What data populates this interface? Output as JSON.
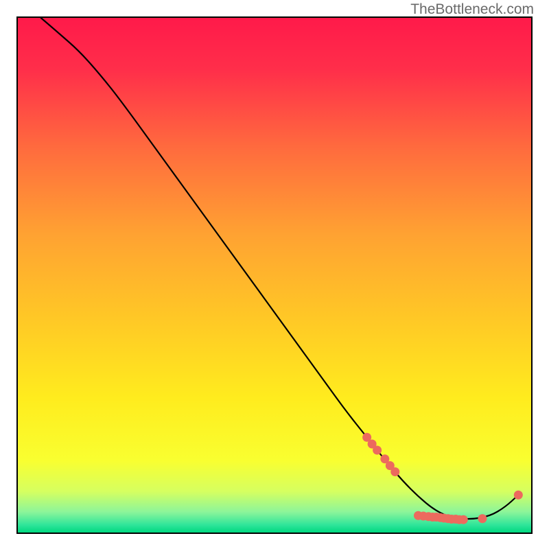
{
  "watermark": "TheBottleneck.com",
  "chart_data": {
    "type": "line",
    "title": "",
    "xlabel": "",
    "ylabel": "",
    "x_range": [
      0,
      100
    ],
    "y_range": [
      0,
      100
    ],
    "note": "No numeric axis ticks or labels visible; values below are normalized positions 0–100 estimated from pixel coordinates.",
    "series": [
      {
        "name": "curve",
        "type": "line",
        "color": "#000000",
        "points": [
          {
            "x": 4.5,
            "y": 100
          },
          {
            "x": 8,
            "y": 97
          },
          {
            "x": 12,
            "y": 93.5
          },
          {
            "x": 16,
            "y": 89
          },
          {
            "x": 20,
            "y": 84
          },
          {
            "x": 28,
            "y": 73
          },
          {
            "x": 36,
            "y": 62
          },
          {
            "x": 44,
            "y": 51
          },
          {
            "x": 52,
            "y": 40
          },
          {
            "x": 60,
            "y": 29
          },
          {
            "x": 64,
            "y": 23.5
          },
          {
            "x": 68,
            "y": 18.5
          },
          {
            "x": 72,
            "y": 13.5
          },
          {
            "x": 75,
            "y": 10
          },
          {
            "x": 78,
            "y": 7
          },
          {
            "x": 81,
            "y": 4.5
          },
          {
            "x": 84,
            "y": 3
          },
          {
            "x": 88,
            "y": 2.5
          },
          {
            "x": 92,
            "y": 3.2
          },
          {
            "x": 95,
            "y": 5
          },
          {
            "x": 97.5,
            "y": 7.3
          }
        ]
      },
      {
        "name": "markers",
        "type": "scatter",
        "color": "#ec6a5e",
        "points": [
          {
            "x": 68,
            "y": 18.5
          },
          {
            "x": 69,
            "y": 17.2
          },
          {
            "x": 70,
            "y": 16
          },
          {
            "x": 71.5,
            "y": 14.3
          },
          {
            "x": 72.5,
            "y": 13
          },
          {
            "x": 73.5,
            "y": 11.8
          },
          {
            "x": 78,
            "y": 3.3
          },
          {
            "x": 79,
            "y": 3.2
          },
          {
            "x": 80,
            "y": 3.1
          },
          {
            "x": 80.8,
            "y": 3.0
          },
          {
            "x": 81.5,
            "y": 3.0
          },
          {
            "x": 82.3,
            "y": 2.9
          },
          {
            "x": 83,
            "y": 2.8
          },
          {
            "x": 83.8,
            "y": 2.7
          },
          {
            "x": 84.5,
            "y": 2.6
          },
          {
            "x": 85.3,
            "y": 2.6
          },
          {
            "x": 86,
            "y": 2.5
          },
          {
            "x": 86.8,
            "y": 2.5
          },
          {
            "x": 90.5,
            "y": 2.7
          },
          {
            "x": 97.5,
            "y": 7.3
          }
        ]
      }
    ],
    "background_gradient": {
      "type": "vertical",
      "stops": [
        {
          "pos": 0,
          "color": "#ff1a4a"
        },
        {
          "pos": 0.1,
          "color": "#ff2e4a"
        },
        {
          "pos": 0.25,
          "color": "#ff6a3e"
        },
        {
          "pos": 0.42,
          "color": "#ffa232"
        },
        {
          "pos": 0.58,
          "color": "#ffc726"
        },
        {
          "pos": 0.74,
          "color": "#ffec1e"
        },
        {
          "pos": 0.86,
          "color": "#f9ff30"
        },
        {
          "pos": 0.92,
          "color": "#d6ff60"
        },
        {
          "pos": 0.96,
          "color": "#8cf59a"
        },
        {
          "pos": 0.985,
          "color": "#30e59a"
        },
        {
          "pos": 1.0,
          "color": "#00d880"
        }
      ]
    }
  }
}
